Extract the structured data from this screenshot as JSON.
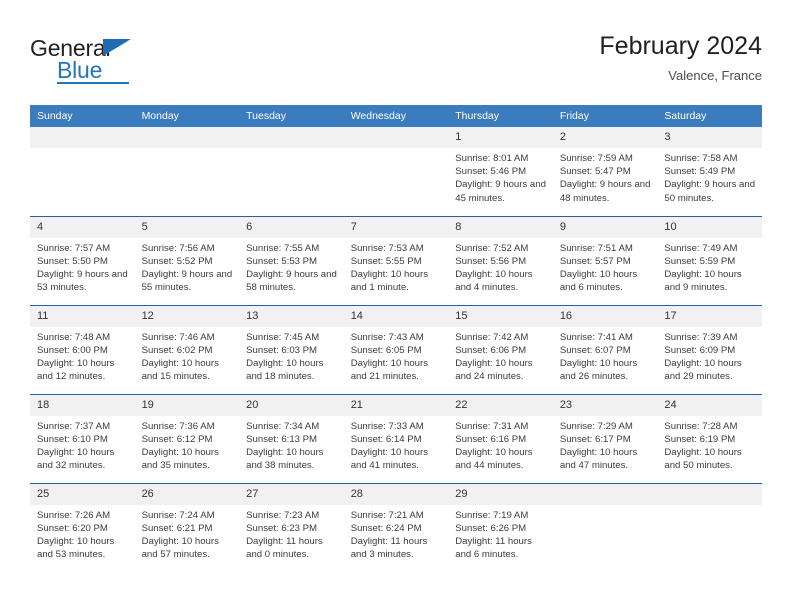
{
  "brand": {
    "name_part1": "General",
    "name_part2": "Blue",
    "triangle_color": "#1f6cb4",
    "blue_color": "#2176bd"
  },
  "header": {
    "title": "February 2024",
    "subtitle": "Valence, France"
  },
  "theme": {
    "header_bg": "#3a7cbe",
    "row_divider": "#24619e",
    "daynum_bg": "#f1f1f1",
    "text": "#3c3c3c"
  },
  "labels": {
    "sunrise_prefix": "Sunrise:",
    "sunset_prefix": "Sunset:",
    "daylight_prefix": "Daylight:"
  },
  "weekdays": [
    "Sunday",
    "Monday",
    "Tuesday",
    "Wednesday",
    "Thursday",
    "Friday",
    "Saturday"
  ],
  "weeks": [
    [
      {
        "day": "",
        "sunrise": "",
        "sunset": "",
        "daylight": ""
      },
      {
        "day": "",
        "sunrise": "",
        "sunset": "",
        "daylight": ""
      },
      {
        "day": "",
        "sunrise": "",
        "sunset": "",
        "daylight": ""
      },
      {
        "day": "",
        "sunrise": "",
        "sunset": "",
        "daylight": ""
      },
      {
        "day": "1",
        "sunrise": "Sunrise: 8:01 AM",
        "sunset": "Sunset: 5:46 PM",
        "daylight": "Daylight: 9 hours and 45 minutes."
      },
      {
        "day": "2",
        "sunrise": "Sunrise: 7:59 AM",
        "sunset": "Sunset: 5:47 PM",
        "daylight": "Daylight: 9 hours and 48 minutes."
      },
      {
        "day": "3",
        "sunrise": "Sunrise: 7:58 AM",
        "sunset": "Sunset: 5:49 PM",
        "daylight": "Daylight: 9 hours and 50 minutes."
      }
    ],
    [
      {
        "day": "4",
        "sunrise": "Sunrise: 7:57 AM",
        "sunset": "Sunset: 5:50 PM",
        "daylight": "Daylight: 9 hours and 53 minutes."
      },
      {
        "day": "5",
        "sunrise": "Sunrise: 7:56 AM",
        "sunset": "Sunset: 5:52 PM",
        "daylight": "Daylight: 9 hours and 55 minutes."
      },
      {
        "day": "6",
        "sunrise": "Sunrise: 7:55 AM",
        "sunset": "Sunset: 5:53 PM",
        "daylight": "Daylight: 9 hours and 58 minutes."
      },
      {
        "day": "7",
        "sunrise": "Sunrise: 7:53 AM",
        "sunset": "Sunset: 5:55 PM",
        "daylight": "Daylight: 10 hours and 1 minute."
      },
      {
        "day": "8",
        "sunrise": "Sunrise: 7:52 AM",
        "sunset": "Sunset: 5:56 PM",
        "daylight": "Daylight: 10 hours and 4 minutes."
      },
      {
        "day": "9",
        "sunrise": "Sunrise: 7:51 AM",
        "sunset": "Sunset: 5:57 PM",
        "daylight": "Daylight: 10 hours and 6 minutes."
      },
      {
        "day": "10",
        "sunrise": "Sunrise: 7:49 AM",
        "sunset": "Sunset: 5:59 PM",
        "daylight": "Daylight: 10 hours and 9 minutes."
      }
    ],
    [
      {
        "day": "11",
        "sunrise": "Sunrise: 7:48 AM",
        "sunset": "Sunset: 6:00 PM",
        "daylight": "Daylight: 10 hours and 12 minutes."
      },
      {
        "day": "12",
        "sunrise": "Sunrise: 7:46 AM",
        "sunset": "Sunset: 6:02 PM",
        "daylight": "Daylight: 10 hours and 15 minutes."
      },
      {
        "day": "13",
        "sunrise": "Sunrise: 7:45 AM",
        "sunset": "Sunset: 6:03 PM",
        "daylight": "Daylight: 10 hours and 18 minutes."
      },
      {
        "day": "14",
        "sunrise": "Sunrise: 7:43 AM",
        "sunset": "Sunset: 6:05 PM",
        "daylight": "Daylight: 10 hours and 21 minutes."
      },
      {
        "day": "15",
        "sunrise": "Sunrise: 7:42 AM",
        "sunset": "Sunset: 6:06 PM",
        "daylight": "Daylight: 10 hours and 24 minutes."
      },
      {
        "day": "16",
        "sunrise": "Sunrise: 7:41 AM",
        "sunset": "Sunset: 6:07 PM",
        "daylight": "Daylight: 10 hours and 26 minutes."
      },
      {
        "day": "17",
        "sunrise": "Sunrise: 7:39 AM",
        "sunset": "Sunset: 6:09 PM",
        "daylight": "Daylight: 10 hours and 29 minutes."
      }
    ],
    [
      {
        "day": "18",
        "sunrise": "Sunrise: 7:37 AM",
        "sunset": "Sunset: 6:10 PM",
        "daylight": "Daylight: 10 hours and 32 minutes."
      },
      {
        "day": "19",
        "sunrise": "Sunrise: 7:36 AM",
        "sunset": "Sunset: 6:12 PM",
        "daylight": "Daylight: 10 hours and 35 minutes."
      },
      {
        "day": "20",
        "sunrise": "Sunrise: 7:34 AM",
        "sunset": "Sunset: 6:13 PM",
        "daylight": "Daylight: 10 hours and 38 minutes."
      },
      {
        "day": "21",
        "sunrise": "Sunrise: 7:33 AM",
        "sunset": "Sunset: 6:14 PM",
        "daylight": "Daylight: 10 hours and 41 minutes."
      },
      {
        "day": "22",
        "sunrise": "Sunrise: 7:31 AM",
        "sunset": "Sunset: 6:16 PM",
        "daylight": "Daylight: 10 hours and 44 minutes."
      },
      {
        "day": "23",
        "sunrise": "Sunrise: 7:29 AM",
        "sunset": "Sunset: 6:17 PM",
        "daylight": "Daylight: 10 hours and 47 minutes."
      },
      {
        "day": "24",
        "sunrise": "Sunrise: 7:28 AM",
        "sunset": "Sunset: 6:19 PM",
        "daylight": "Daylight: 10 hours and 50 minutes."
      }
    ],
    [
      {
        "day": "25",
        "sunrise": "Sunrise: 7:26 AM",
        "sunset": "Sunset: 6:20 PM",
        "daylight": "Daylight: 10 hours and 53 minutes."
      },
      {
        "day": "26",
        "sunrise": "Sunrise: 7:24 AM",
        "sunset": "Sunset: 6:21 PM",
        "daylight": "Daylight: 10 hours and 57 minutes."
      },
      {
        "day": "27",
        "sunrise": "Sunrise: 7:23 AM",
        "sunset": "Sunset: 6:23 PM",
        "daylight": "Daylight: 11 hours and 0 minutes."
      },
      {
        "day": "28",
        "sunrise": "Sunrise: 7:21 AM",
        "sunset": "Sunset: 6:24 PM",
        "daylight": "Daylight: 11 hours and 3 minutes."
      },
      {
        "day": "29",
        "sunrise": "Sunrise: 7:19 AM",
        "sunset": "Sunset: 6:26 PM",
        "daylight": "Daylight: 11 hours and 6 minutes."
      },
      {
        "day": "",
        "sunrise": "",
        "sunset": "",
        "daylight": ""
      },
      {
        "day": "",
        "sunrise": "",
        "sunset": "",
        "daylight": ""
      }
    ]
  ]
}
